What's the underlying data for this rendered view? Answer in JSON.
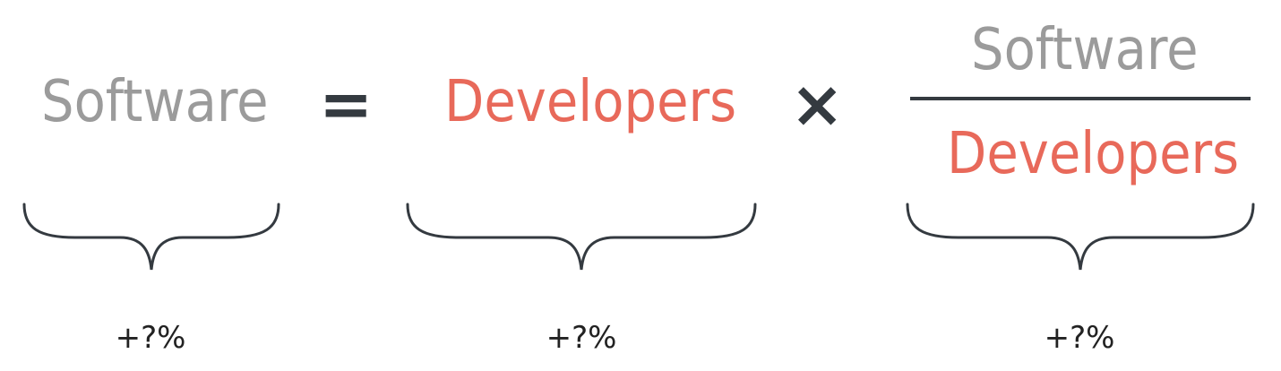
{
  "equation": {
    "lhs": "Software",
    "equals": "=",
    "factor": "Developers",
    "times": "×",
    "fraction": {
      "numerator": "Software",
      "denominator": "Developers"
    }
  },
  "annotations": [
    {
      "label": "+?%"
    },
    {
      "label": "+?%"
    },
    {
      "label": "+?%"
    }
  ],
  "colors": {
    "software": "#9b9b9b",
    "developers": "#e8695a",
    "operators": "#343a40",
    "annotation": "#222222"
  }
}
